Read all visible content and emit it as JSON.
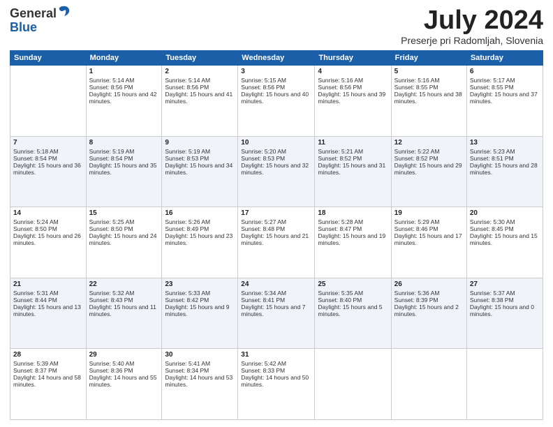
{
  "header": {
    "logo_general": "General",
    "logo_blue": "Blue",
    "month_year": "July 2024",
    "location": "Preserje pri Radomljah, Slovenia"
  },
  "weekdays": [
    "Sunday",
    "Monday",
    "Tuesday",
    "Wednesday",
    "Thursday",
    "Friday",
    "Saturday"
  ],
  "weeks": [
    [
      {
        "day": "",
        "sunrise": "",
        "sunset": "",
        "daylight": "",
        "empty": true
      },
      {
        "day": "1",
        "sunrise": "Sunrise: 5:14 AM",
        "sunset": "Sunset: 8:56 PM",
        "daylight": "Daylight: 15 hours and 42 minutes."
      },
      {
        "day": "2",
        "sunrise": "Sunrise: 5:14 AM",
        "sunset": "Sunset: 8:56 PM",
        "daylight": "Daylight: 15 hours and 41 minutes."
      },
      {
        "day": "3",
        "sunrise": "Sunrise: 5:15 AM",
        "sunset": "Sunset: 8:56 PM",
        "daylight": "Daylight: 15 hours and 40 minutes."
      },
      {
        "day": "4",
        "sunrise": "Sunrise: 5:16 AM",
        "sunset": "Sunset: 8:56 PM",
        "daylight": "Daylight: 15 hours and 39 minutes."
      },
      {
        "day": "5",
        "sunrise": "Sunrise: 5:16 AM",
        "sunset": "Sunset: 8:55 PM",
        "daylight": "Daylight: 15 hours and 38 minutes."
      },
      {
        "day": "6",
        "sunrise": "Sunrise: 5:17 AM",
        "sunset": "Sunset: 8:55 PM",
        "daylight": "Daylight: 15 hours and 37 minutes."
      }
    ],
    [
      {
        "day": "7",
        "sunrise": "Sunrise: 5:18 AM",
        "sunset": "Sunset: 8:54 PM",
        "daylight": "Daylight: 15 hours and 36 minutes."
      },
      {
        "day": "8",
        "sunrise": "Sunrise: 5:19 AM",
        "sunset": "Sunset: 8:54 PM",
        "daylight": "Daylight: 15 hours and 35 minutes."
      },
      {
        "day": "9",
        "sunrise": "Sunrise: 5:19 AM",
        "sunset": "Sunset: 8:53 PM",
        "daylight": "Daylight: 15 hours and 34 minutes."
      },
      {
        "day": "10",
        "sunrise": "Sunrise: 5:20 AM",
        "sunset": "Sunset: 8:53 PM",
        "daylight": "Daylight: 15 hours and 32 minutes."
      },
      {
        "day": "11",
        "sunrise": "Sunrise: 5:21 AM",
        "sunset": "Sunset: 8:52 PM",
        "daylight": "Daylight: 15 hours and 31 minutes."
      },
      {
        "day": "12",
        "sunrise": "Sunrise: 5:22 AM",
        "sunset": "Sunset: 8:52 PM",
        "daylight": "Daylight: 15 hours and 29 minutes."
      },
      {
        "day": "13",
        "sunrise": "Sunrise: 5:23 AM",
        "sunset": "Sunset: 8:51 PM",
        "daylight": "Daylight: 15 hours and 28 minutes."
      }
    ],
    [
      {
        "day": "14",
        "sunrise": "Sunrise: 5:24 AM",
        "sunset": "Sunset: 8:50 PM",
        "daylight": "Daylight: 15 hours and 26 minutes."
      },
      {
        "day": "15",
        "sunrise": "Sunrise: 5:25 AM",
        "sunset": "Sunset: 8:50 PM",
        "daylight": "Daylight: 15 hours and 24 minutes."
      },
      {
        "day": "16",
        "sunrise": "Sunrise: 5:26 AM",
        "sunset": "Sunset: 8:49 PM",
        "daylight": "Daylight: 15 hours and 23 minutes."
      },
      {
        "day": "17",
        "sunrise": "Sunrise: 5:27 AM",
        "sunset": "Sunset: 8:48 PM",
        "daylight": "Daylight: 15 hours and 21 minutes."
      },
      {
        "day": "18",
        "sunrise": "Sunrise: 5:28 AM",
        "sunset": "Sunset: 8:47 PM",
        "daylight": "Daylight: 15 hours and 19 minutes."
      },
      {
        "day": "19",
        "sunrise": "Sunrise: 5:29 AM",
        "sunset": "Sunset: 8:46 PM",
        "daylight": "Daylight: 15 hours and 17 minutes."
      },
      {
        "day": "20",
        "sunrise": "Sunrise: 5:30 AM",
        "sunset": "Sunset: 8:45 PM",
        "daylight": "Daylight: 15 hours and 15 minutes."
      }
    ],
    [
      {
        "day": "21",
        "sunrise": "Sunrise: 5:31 AM",
        "sunset": "Sunset: 8:44 PM",
        "daylight": "Daylight: 15 hours and 13 minutes."
      },
      {
        "day": "22",
        "sunrise": "Sunrise: 5:32 AM",
        "sunset": "Sunset: 8:43 PM",
        "daylight": "Daylight: 15 hours and 11 minutes."
      },
      {
        "day": "23",
        "sunrise": "Sunrise: 5:33 AM",
        "sunset": "Sunset: 8:42 PM",
        "daylight": "Daylight: 15 hours and 9 minutes."
      },
      {
        "day": "24",
        "sunrise": "Sunrise: 5:34 AM",
        "sunset": "Sunset: 8:41 PM",
        "daylight": "Daylight: 15 hours and 7 minutes."
      },
      {
        "day": "25",
        "sunrise": "Sunrise: 5:35 AM",
        "sunset": "Sunset: 8:40 PM",
        "daylight": "Daylight: 15 hours and 5 minutes."
      },
      {
        "day": "26",
        "sunrise": "Sunrise: 5:36 AM",
        "sunset": "Sunset: 8:39 PM",
        "daylight": "Daylight: 15 hours and 2 minutes."
      },
      {
        "day": "27",
        "sunrise": "Sunrise: 5:37 AM",
        "sunset": "Sunset: 8:38 PM",
        "daylight": "Daylight: 15 hours and 0 minutes."
      }
    ],
    [
      {
        "day": "28",
        "sunrise": "Sunrise: 5:39 AM",
        "sunset": "Sunset: 8:37 PM",
        "daylight": "Daylight: 14 hours and 58 minutes."
      },
      {
        "day": "29",
        "sunrise": "Sunrise: 5:40 AM",
        "sunset": "Sunset: 8:36 PM",
        "daylight": "Daylight: 14 hours and 55 minutes."
      },
      {
        "day": "30",
        "sunrise": "Sunrise: 5:41 AM",
        "sunset": "Sunset: 8:34 PM",
        "daylight": "Daylight: 14 hours and 53 minutes."
      },
      {
        "day": "31",
        "sunrise": "Sunrise: 5:42 AM",
        "sunset": "Sunset: 8:33 PM",
        "daylight": "Daylight: 14 hours and 50 minutes."
      },
      {
        "day": "",
        "sunrise": "",
        "sunset": "",
        "daylight": "",
        "empty": true
      },
      {
        "day": "",
        "sunrise": "",
        "sunset": "",
        "daylight": "",
        "empty": true
      },
      {
        "day": "",
        "sunrise": "",
        "sunset": "",
        "daylight": "",
        "empty": true
      }
    ]
  ]
}
